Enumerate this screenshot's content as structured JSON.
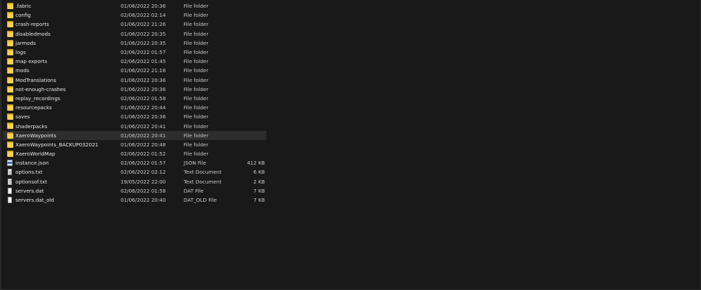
{
  "files": [
    {
      "name": ".fabric",
      "date": "01/06/2022 20:36",
      "type": "File folder",
      "size": "",
      "icon": "folder-icon"
    },
    {
      "name": "config",
      "date": "02/06/2022 02:14",
      "type": "File folder",
      "size": "",
      "icon": "folder-icon"
    },
    {
      "name": "crash-reports",
      "date": "01/06/2022 21:26",
      "type": "File folder",
      "size": "",
      "icon": "folder-icon"
    },
    {
      "name": "disabledmods",
      "date": "01/06/2022 20:35",
      "type": "File folder",
      "size": "",
      "icon": "folder-icon"
    },
    {
      "name": "jarmods",
      "date": "01/06/2022 20:35",
      "type": "File folder",
      "size": "",
      "icon": "folder-icon"
    },
    {
      "name": "logs",
      "date": "02/06/2022 01:57",
      "type": "File folder",
      "size": "",
      "icon": "folder-icon"
    },
    {
      "name": "map exports",
      "date": "02/06/2022 01:45",
      "type": "File folder",
      "size": "",
      "icon": "folder-icon"
    },
    {
      "name": "mods",
      "date": "01/06/2022 21:16",
      "type": "File folder",
      "size": "",
      "icon": "folder-icon"
    },
    {
      "name": "ModTranslations",
      "date": "01/06/2022 20:36",
      "type": "File folder",
      "size": "",
      "icon": "folder-icon"
    },
    {
      "name": "not-enough-crashes",
      "date": "01/06/2022 20:36",
      "type": "File folder",
      "size": "",
      "icon": "folder-icon"
    },
    {
      "name": "replay_recordings",
      "date": "02/06/2022 01:58",
      "type": "File folder",
      "size": "",
      "icon": "folder-icon"
    },
    {
      "name": "resourcepacks",
      "date": "01/06/2022 20:44",
      "type": "File folder",
      "size": "",
      "icon": "folder-icon"
    },
    {
      "name": "saves",
      "date": "01/06/2022 20:36",
      "type": "File folder",
      "size": "",
      "icon": "folder-icon"
    },
    {
      "name": "shaderpacks",
      "date": "01/06/2022 20:41",
      "type": "File folder",
      "size": "",
      "icon": "folder-icon"
    },
    {
      "name": "XaeroWaypoints",
      "date": "01/06/2022 20:41",
      "type": "File folder",
      "size": "",
      "icon": "folder-icon",
      "selected": true
    },
    {
      "name": "XaeroWaypoints_BACKUP032021",
      "date": "01/06/2022 20:48",
      "type": "File folder",
      "size": "",
      "icon": "folder-icon"
    },
    {
      "name": "XaeroWorldMap",
      "date": "02/06/2022 01:52",
      "type": "File folder",
      "size": "",
      "icon": "folder-icon"
    },
    {
      "name": "instance.json",
      "date": "02/06/2022 01:57",
      "type": "JSON File",
      "size": "412 KB",
      "icon": "json-file-icon"
    },
    {
      "name": "options.txt",
      "date": "02/06/2022 02:12",
      "type": "Text Document",
      "size": "6 KB",
      "icon": "text-file-icon"
    },
    {
      "name": "optionsof.txt",
      "date": "19/05/2022 22:00",
      "type": "Text Document",
      "size": "2 KB",
      "icon": "text-file-icon"
    },
    {
      "name": "servers.dat",
      "date": "02/06/2022 01:58",
      "type": "DAT File",
      "size": "7 KB",
      "icon": "file-icon"
    },
    {
      "name": "servers.dat_old",
      "date": "01/06/2022 20:40",
      "type": "DAT_OLD File",
      "size": "7 KB",
      "icon": "file-icon"
    }
  ],
  "colors": {
    "background": "#191919",
    "selected_row": "#2d2d2d",
    "folder": "#f7cf5a",
    "text": "#e8e8e8"
  }
}
